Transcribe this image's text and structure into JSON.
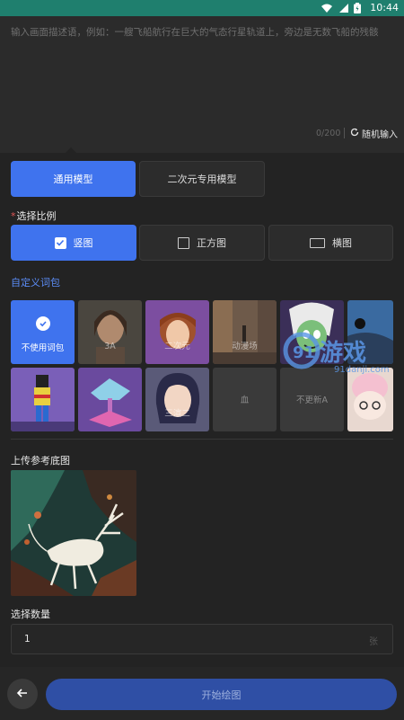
{
  "status_bar": {
    "time": "10:44",
    "icons": [
      "wifi-icon",
      "signal-icon",
      "battery-icon"
    ]
  },
  "prompt": {
    "placeholder": "输入画面描述语，例如：一艘飞船航行在巨大的气态行星轨道上，旁边是无数飞船的残骸",
    "counter": "0/200",
    "random_label": "随机输入"
  },
  "model_tabs": [
    {
      "label": "通用模型",
      "active": true
    },
    {
      "label": "二次元专用模型",
      "active": false
    }
  ],
  "ratio": {
    "title": "选择比例",
    "required_mark": "*",
    "options": [
      {
        "label": "竖图",
        "active": true
      },
      {
        "label": "正方图",
        "active": false
      },
      {
        "label": "横图",
        "active": false
      }
    ]
  },
  "custom_link": "自定义词包",
  "style_grid": [
    {
      "label": "不使用词包",
      "selected": true
    },
    {
      "label": "3A"
    },
    {
      "label": "二次元"
    },
    {
      "label": "动漫场"
    },
    {
      "label": ""
    },
    {
      "label": ""
    },
    {
      "label": ""
    },
    {
      "label": ""
    },
    {
      "label": "三渲二"
    },
    {
      "label": "血"
    },
    {
      "label": "不更新A"
    },
    {
      "label": ""
    }
  ],
  "upload": {
    "title": "上传参考底图"
  },
  "quantity": {
    "title": "选择数量",
    "value": "1",
    "unit": "张"
  },
  "bottom": {
    "start_label": "开始绘图"
  },
  "watermark": {
    "brand": "游戏",
    "url": "91danji.com"
  },
  "colors": {
    "accent": "#3f73ee",
    "status_bar": "#1f7f6e",
    "link": "#5b8cf5"
  }
}
